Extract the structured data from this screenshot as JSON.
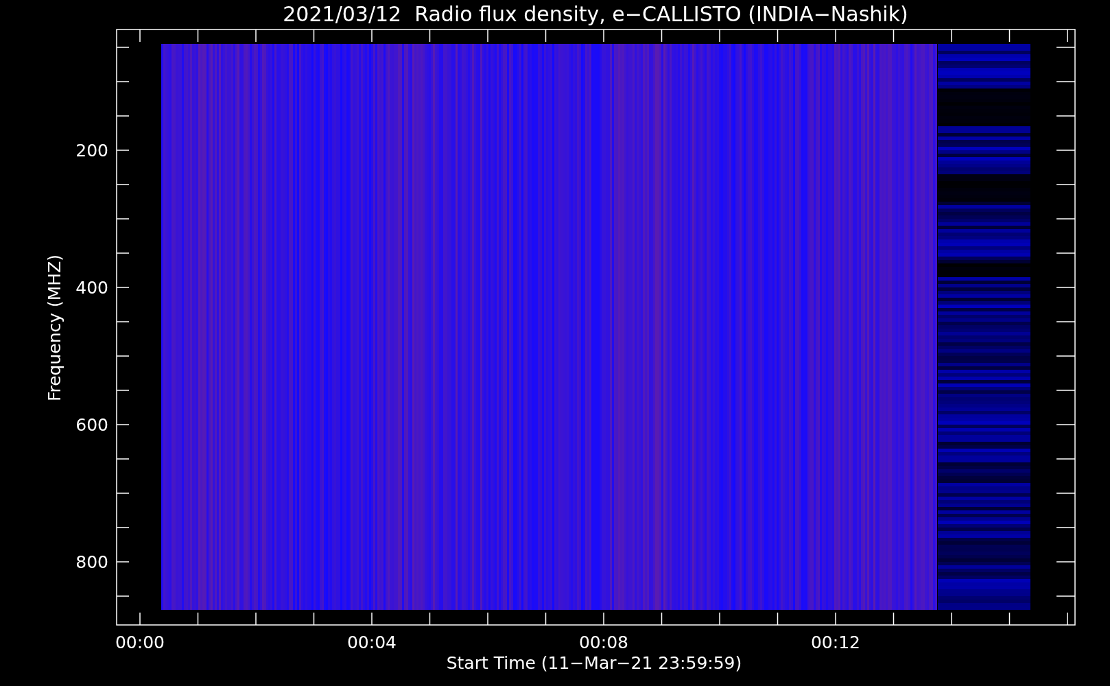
{
  "title": "2021/03/12  Radio flux density, e−CALLISTO (INDIA−Nashik)",
  "y_axis": {
    "label": "Frequency (MHZ)",
    "ticks": [
      "200",
      "400",
      "600",
      "800"
    ]
  },
  "x_axis": {
    "label": "Start Time (11−Mar−21 23:59:59)",
    "ticks": [
      "00:00",
      "00:04",
      "00:08",
      "00:12"
    ]
  }
}
